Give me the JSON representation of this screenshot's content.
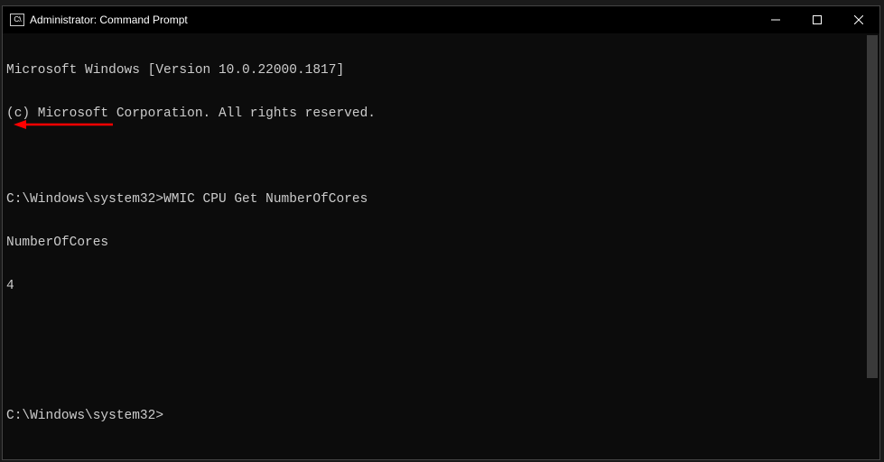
{
  "titlebar": {
    "icon_label": "C:\\",
    "title": "Administrator: Command Prompt"
  },
  "terminal": {
    "line1": "Microsoft Windows [Version 10.0.22000.1817]",
    "line2": "(c) Microsoft Corporation. All rights reserved.",
    "prompt1_path": "C:\\Windows\\system32>",
    "prompt1_cmd": "WMIC CPU Get NumberOfCores",
    "output_header": "NumberOfCores",
    "output_value": "4",
    "prompt2_path": "C:\\Windows\\system32>"
  }
}
